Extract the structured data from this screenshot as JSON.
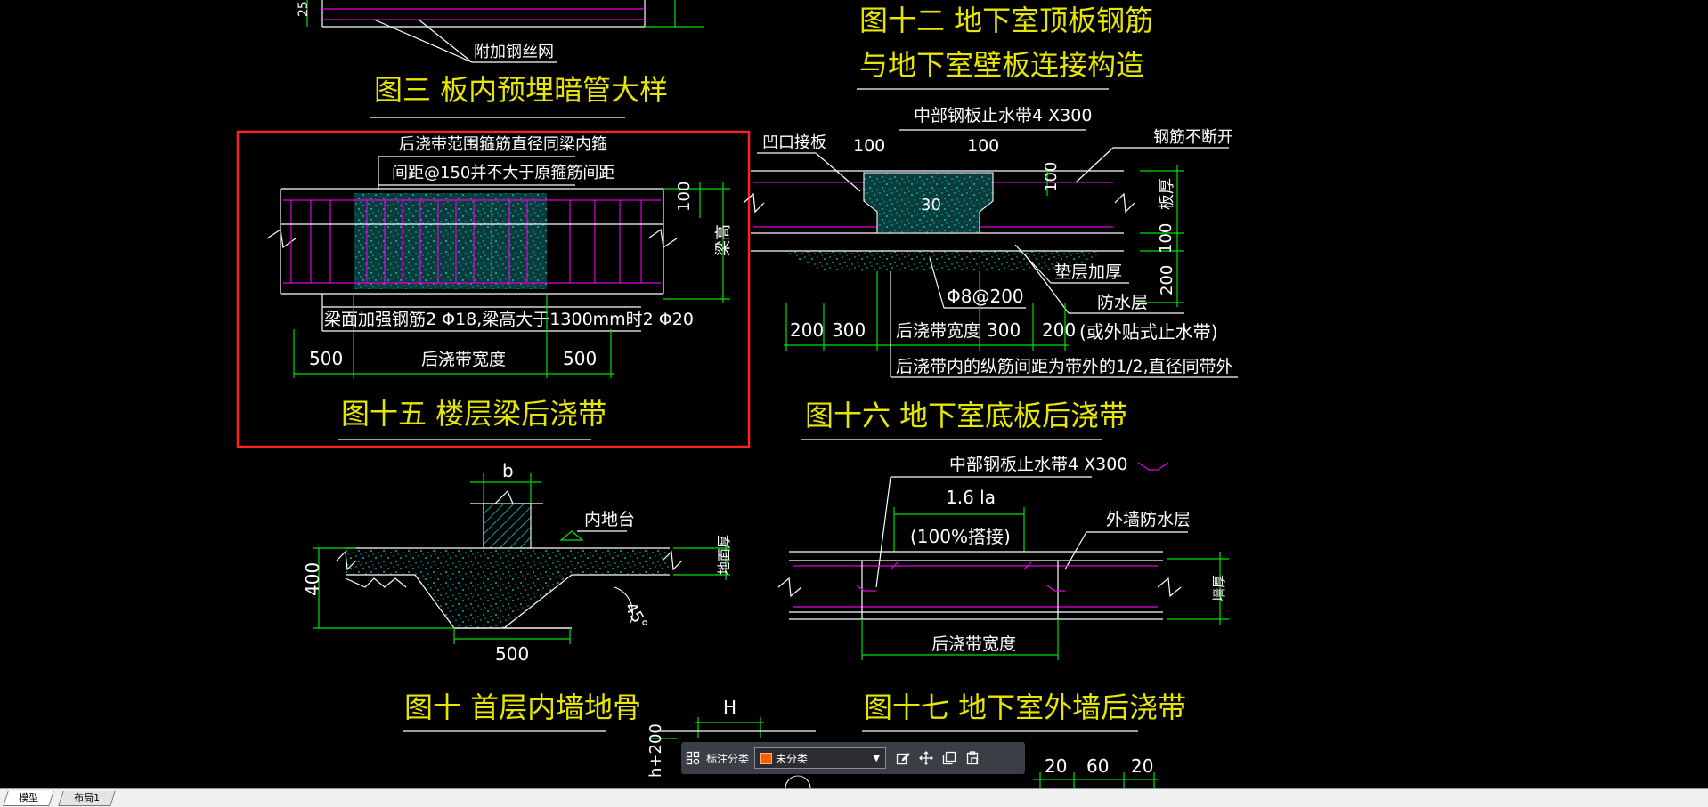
{
  "drawing": {
    "fig3": {
      "title": "图三  板内预埋暗管大样",
      "note": "附加钢丝网",
      "dim_left": "25"
    },
    "fig12": {
      "title_line1": "图十二  地下室顶板钢筋",
      "title_line2": "与地下室壁板连接构造"
    },
    "fig15": {
      "title": "图十五  楼层梁后浇带",
      "note_line1": "后浇带范围箍筋直径同梁内箍",
      "note_line2": "间距@150并不大于原箍筋间距",
      "rebar_note": "梁面加强钢筋2 Φ18,梁高大于1300mm时2 Φ20",
      "dim_100": "100",
      "dim_beam_height": "梁高",
      "dim_left": "500",
      "dim_mid": "后浇带宽度",
      "dim_right": "500"
    },
    "fig16": {
      "title": "图十六  地下室底板后浇带",
      "waterstop": "中部钢板止水带4 X300",
      "recess": "凹口接板",
      "dim_100a": "100",
      "dim_100b": "100",
      "continuous": "钢筋不断开",
      "dim_30": "30",
      "dim_100c": "100",
      "slab_thk": "板厚",
      "dim_100d": "100",
      "dim_200v": "200",
      "cushion": "垫层加厚",
      "rebar": "Φ8@200",
      "waterproof": "防水层",
      "waterproof2": "(或外贴式止水带)",
      "dim_200a": "200",
      "dim_300a": "300",
      "width": "后浇带宽度",
      "dim_300b": "300",
      "dim_200b": "200",
      "spacing_note": "后浇带内的纵筋间距为带外的1/2,直径同带外"
    },
    "fig10": {
      "title": "图十  首层内墙地骨",
      "dim_b": "b",
      "inner_floor": "内地台",
      "dim_400": "400",
      "floor_thk": "地面厚",
      "angle": "45°",
      "dim_500": "500"
    },
    "fig17": {
      "title": "图十七  地下室外墙后浇带",
      "waterstop": "中部钢板止水带4 X300",
      "lap_len": "1.6  la",
      "lap": "(100%搭接)",
      "ext_waterproof": "外墙防水层",
      "wall_thk": "墙厚",
      "width": "后浇带宽度"
    },
    "bottom": {
      "dim_H": "H",
      "dim_h200": "h+200",
      "dim_20a": "20",
      "dim_60": "60",
      "dim_20b": "20"
    }
  },
  "toolbar": {
    "label": "标注分类",
    "category": "未分类",
    "category_color": "#ff5a00"
  },
  "tabs": {
    "model": "模型",
    "layout1": "布局1"
  },
  "colors": {
    "background": "#000000",
    "title_text": "#e6e600",
    "dimension_lines": "#00e000",
    "rebar": "#e000e0",
    "concrete_hatch": "#00e6e6",
    "selection_box": "#ff2020"
  }
}
